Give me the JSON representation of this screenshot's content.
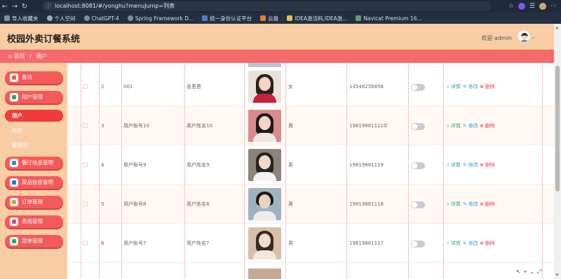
{
  "browser": {
    "url": "localhost:8081/#/yonghu?menuJump=列表",
    "bookmarks": [
      "导入收藏夹",
      "个人空间",
      "ChatGPT-4",
      "Spring Framework D...",
      "统一身份认证平台",
      "云盘",
      "IDEA激活码,IDEA激...",
      "Navicat Premium 16..."
    ]
  },
  "app": {
    "title": "校园外卖订餐系统",
    "welcome": "欢迎 admin",
    "breadcrumb": {
      "home": "首页",
      "sep": "/",
      "current": "用户"
    }
  },
  "sidebar": {
    "items": [
      {
        "label": "首页",
        "icon": "home-icon"
      },
      {
        "label": "用户管理",
        "icon": "table-icon"
      },
      {
        "label": "餐厅信息管理",
        "icon": "chart-icon"
      },
      {
        "label": "菜品信息管理",
        "icon": "bookmark-icon"
      },
      {
        "label": "订单管理",
        "icon": "order-icon"
      },
      {
        "label": "系统管理",
        "icon": "grid-icon"
      },
      {
        "label": "菜单管理",
        "icon": "doc-icon"
      }
    ],
    "sub": [
      "用户",
      "商家",
      "管理员"
    ]
  },
  "table": {
    "actions": {
      "detail": "详情",
      "edit": "修改",
      "delete": "删除"
    },
    "rows": [
      {
        "index": "2",
        "account": "001",
        "name": "张恩恩",
        "gender": "女",
        "phone": "13548256858"
      },
      {
        "index": "3",
        "account": "用户账号10",
        "name": "用户姓名10",
        "gender": "男",
        "phone": "19819881111O"
      },
      {
        "index": "4",
        "account": "用户账号9",
        "name": "用户姓名9",
        "gender": "男",
        "phone": "19819881119"
      },
      {
        "index": "5",
        "account": "用户账号8",
        "name": "用户姓名8",
        "gender": "男",
        "phone": "19819881118"
      },
      {
        "index": "6",
        "account": "用户账号7",
        "name": "用户姓名7",
        "gender": "男",
        "phone": "19819881117"
      }
    ]
  }
}
